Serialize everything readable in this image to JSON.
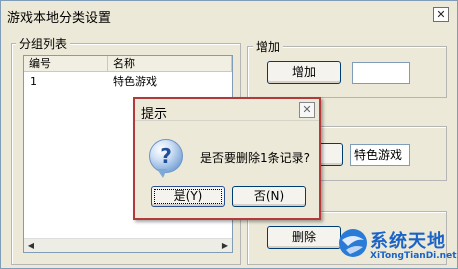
{
  "window": {
    "title": "游戏本地分类设置",
    "close_glyph": "✕"
  },
  "group_list": {
    "label": "分组列表",
    "columns": [
      "编号",
      "名称"
    ],
    "rows": [
      {
        "id": "1",
        "name": "特色游戏"
      }
    ],
    "scroll_left": "◀",
    "scroll_right": "▶"
  },
  "group_add": {
    "label": "增加",
    "button": "增加",
    "value": ""
  },
  "group_edit": {
    "value": "特色游戏"
  },
  "group_delete": {
    "button": "删除"
  },
  "dialog": {
    "title": "提示",
    "close_glyph": "✕",
    "icon": "question-icon",
    "icon_glyph": "?",
    "message": "是否要删除1条记录?",
    "yes_label": "是(Y)",
    "no_label": "否(N)"
  },
  "watermark": {
    "name": "系统天地",
    "url": "XiTongTianDi.net"
  }
}
